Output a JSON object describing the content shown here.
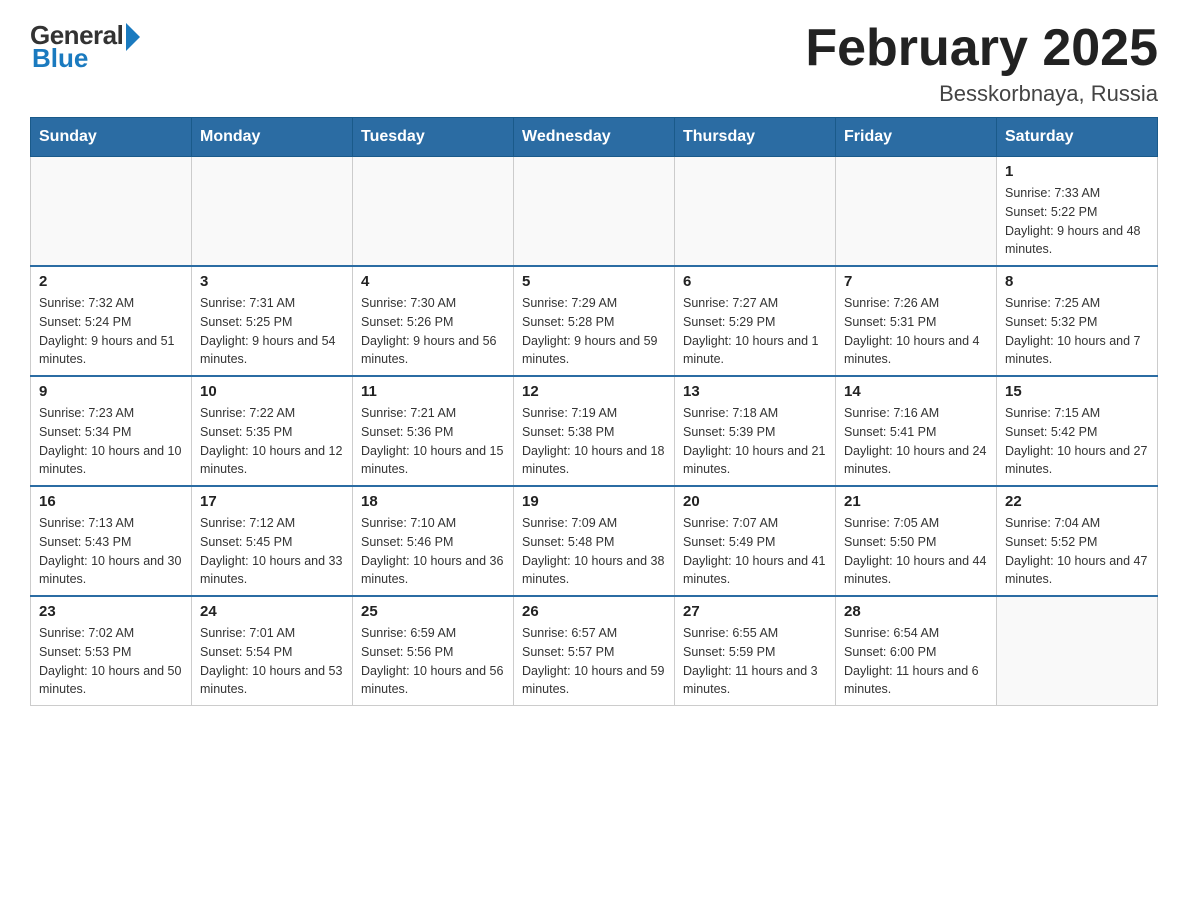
{
  "header": {
    "logo": {
      "general": "General",
      "blue": "Blue"
    },
    "title": "February 2025",
    "location": "Besskorbnaya, Russia"
  },
  "weekdays": [
    "Sunday",
    "Monday",
    "Tuesday",
    "Wednesday",
    "Thursday",
    "Friday",
    "Saturday"
  ],
  "weeks": [
    [
      {
        "day": "",
        "info": ""
      },
      {
        "day": "",
        "info": ""
      },
      {
        "day": "",
        "info": ""
      },
      {
        "day": "",
        "info": ""
      },
      {
        "day": "",
        "info": ""
      },
      {
        "day": "",
        "info": ""
      },
      {
        "day": "1",
        "info": "Sunrise: 7:33 AM\nSunset: 5:22 PM\nDaylight: 9 hours and 48 minutes."
      }
    ],
    [
      {
        "day": "2",
        "info": "Sunrise: 7:32 AM\nSunset: 5:24 PM\nDaylight: 9 hours and 51 minutes."
      },
      {
        "day": "3",
        "info": "Sunrise: 7:31 AM\nSunset: 5:25 PM\nDaylight: 9 hours and 54 minutes."
      },
      {
        "day": "4",
        "info": "Sunrise: 7:30 AM\nSunset: 5:26 PM\nDaylight: 9 hours and 56 minutes."
      },
      {
        "day": "5",
        "info": "Sunrise: 7:29 AM\nSunset: 5:28 PM\nDaylight: 9 hours and 59 minutes."
      },
      {
        "day": "6",
        "info": "Sunrise: 7:27 AM\nSunset: 5:29 PM\nDaylight: 10 hours and 1 minute."
      },
      {
        "day": "7",
        "info": "Sunrise: 7:26 AM\nSunset: 5:31 PM\nDaylight: 10 hours and 4 minutes."
      },
      {
        "day": "8",
        "info": "Sunrise: 7:25 AM\nSunset: 5:32 PM\nDaylight: 10 hours and 7 minutes."
      }
    ],
    [
      {
        "day": "9",
        "info": "Sunrise: 7:23 AM\nSunset: 5:34 PM\nDaylight: 10 hours and 10 minutes."
      },
      {
        "day": "10",
        "info": "Sunrise: 7:22 AM\nSunset: 5:35 PM\nDaylight: 10 hours and 12 minutes."
      },
      {
        "day": "11",
        "info": "Sunrise: 7:21 AM\nSunset: 5:36 PM\nDaylight: 10 hours and 15 minutes."
      },
      {
        "day": "12",
        "info": "Sunrise: 7:19 AM\nSunset: 5:38 PM\nDaylight: 10 hours and 18 minutes."
      },
      {
        "day": "13",
        "info": "Sunrise: 7:18 AM\nSunset: 5:39 PM\nDaylight: 10 hours and 21 minutes."
      },
      {
        "day": "14",
        "info": "Sunrise: 7:16 AM\nSunset: 5:41 PM\nDaylight: 10 hours and 24 minutes."
      },
      {
        "day": "15",
        "info": "Sunrise: 7:15 AM\nSunset: 5:42 PM\nDaylight: 10 hours and 27 minutes."
      }
    ],
    [
      {
        "day": "16",
        "info": "Sunrise: 7:13 AM\nSunset: 5:43 PM\nDaylight: 10 hours and 30 minutes."
      },
      {
        "day": "17",
        "info": "Sunrise: 7:12 AM\nSunset: 5:45 PM\nDaylight: 10 hours and 33 minutes."
      },
      {
        "day": "18",
        "info": "Sunrise: 7:10 AM\nSunset: 5:46 PM\nDaylight: 10 hours and 36 minutes."
      },
      {
        "day": "19",
        "info": "Sunrise: 7:09 AM\nSunset: 5:48 PM\nDaylight: 10 hours and 38 minutes."
      },
      {
        "day": "20",
        "info": "Sunrise: 7:07 AM\nSunset: 5:49 PM\nDaylight: 10 hours and 41 minutes."
      },
      {
        "day": "21",
        "info": "Sunrise: 7:05 AM\nSunset: 5:50 PM\nDaylight: 10 hours and 44 minutes."
      },
      {
        "day": "22",
        "info": "Sunrise: 7:04 AM\nSunset: 5:52 PM\nDaylight: 10 hours and 47 minutes."
      }
    ],
    [
      {
        "day": "23",
        "info": "Sunrise: 7:02 AM\nSunset: 5:53 PM\nDaylight: 10 hours and 50 minutes."
      },
      {
        "day": "24",
        "info": "Sunrise: 7:01 AM\nSunset: 5:54 PM\nDaylight: 10 hours and 53 minutes."
      },
      {
        "day": "25",
        "info": "Sunrise: 6:59 AM\nSunset: 5:56 PM\nDaylight: 10 hours and 56 minutes."
      },
      {
        "day": "26",
        "info": "Sunrise: 6:57 AM\nSunset: 5:57 PM\nDaylight: 10 hours and 59 minutes."
      },
      {
        "day": "27",
        "info": "Sunrise: 6:55 AM\nSunset: 5:59 PM\nDaylight: 11 hours and 3 minutes."
      },
      {
        "day": "28",
        "info": "Sunrise: 6:54 AM\nSunset: 6:00 PM\nDaylight: 11 hours and 6 minutes."
      },
      {
        "day": "",
        "info": ""
      }
    ]
  ]
}
